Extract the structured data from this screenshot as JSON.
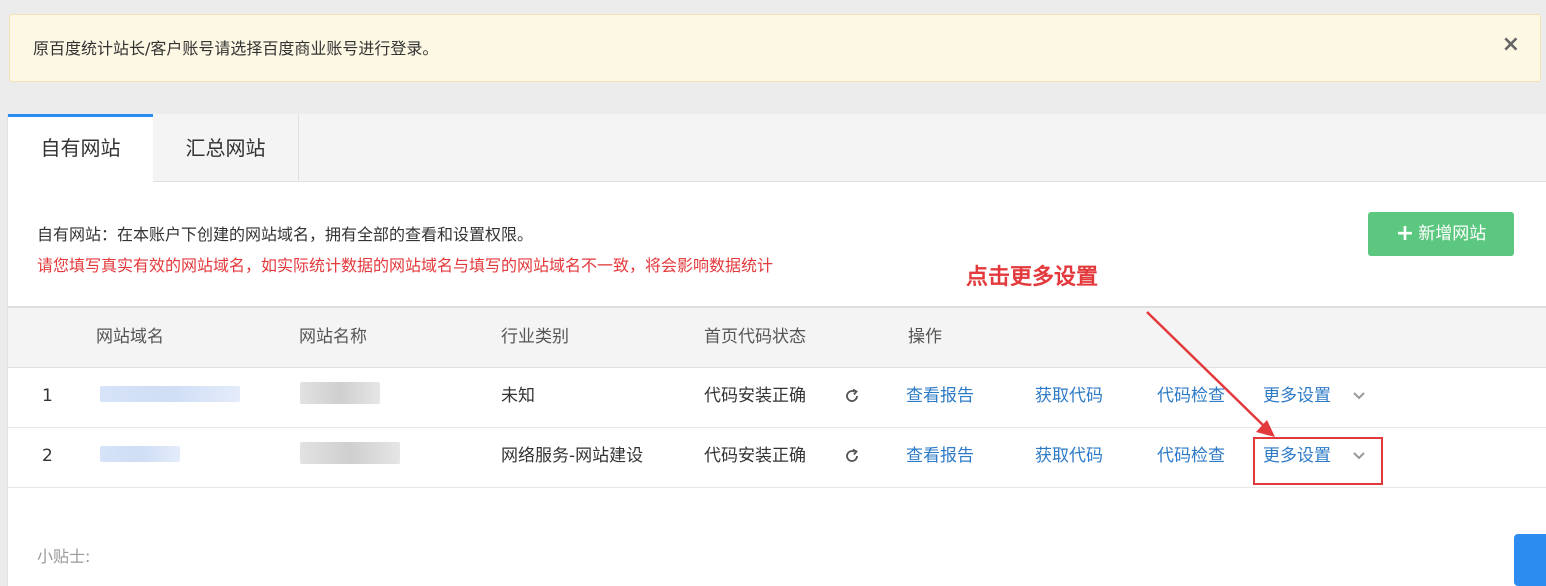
{
  "notice": {
    "text": "原百度统计站长/客户账号请选择百度商业账号进行登录。",
    "close_label": "×"
  },
  "tabs": [
    {
      "label": "自有网站",
      "active": true
    },
    {
      "label": "汇总网站",
      "active": false
    }
  ],
  "description": "自有网站：在本账户下创建的网站域名，拥有全部的查看和设置权限。",
  "warning": "请您填写真实有效的网站域名，如实际统计数据的网站域名与填写的网站域名不一致，将会影响数据统计",
  "add_button": {
    "icon": "plus-icon",
    "label": "新增网站"
  },
  "annotation": {
    "text": "点击更多设置",
    "color": "#e4393c"
  },
  "table": {
    "headers": {
      "domain": "网站域名",
      "name": "网站名称",
      "industry": "行业类别",
      "status": "首页代码状态",
      "actions": "操作"
    },
    "rows": [
      {
        "index": "1",
        "industry": "未知",
        "status": "代码安装正确",
        "view_report": "查看报告",
        "get_code": "获取代码",
        "check_code": "代码检查",
        "more_settings": "更多设置"
      },
      {
        "index": "2",
        "industry": "网络服务-网站建设",
        "status": "代码安装正确",
        "view_report": "查看报告",
        "get_code": "获取代码",
        "check_code": "代码检查",
        "more_settings": "更多设置"
      }
    ]
  },
  "tips": {
    "title": "小贴士:"
  },
  "colors": {
    "link": "#2d7ac6",
    "accent_green": "#5cc77f",
    "tab_active": "#2d8cf0",
    "warning": "#e4393c",
    "notice_bg": "#fcf8e3"
  }
}
